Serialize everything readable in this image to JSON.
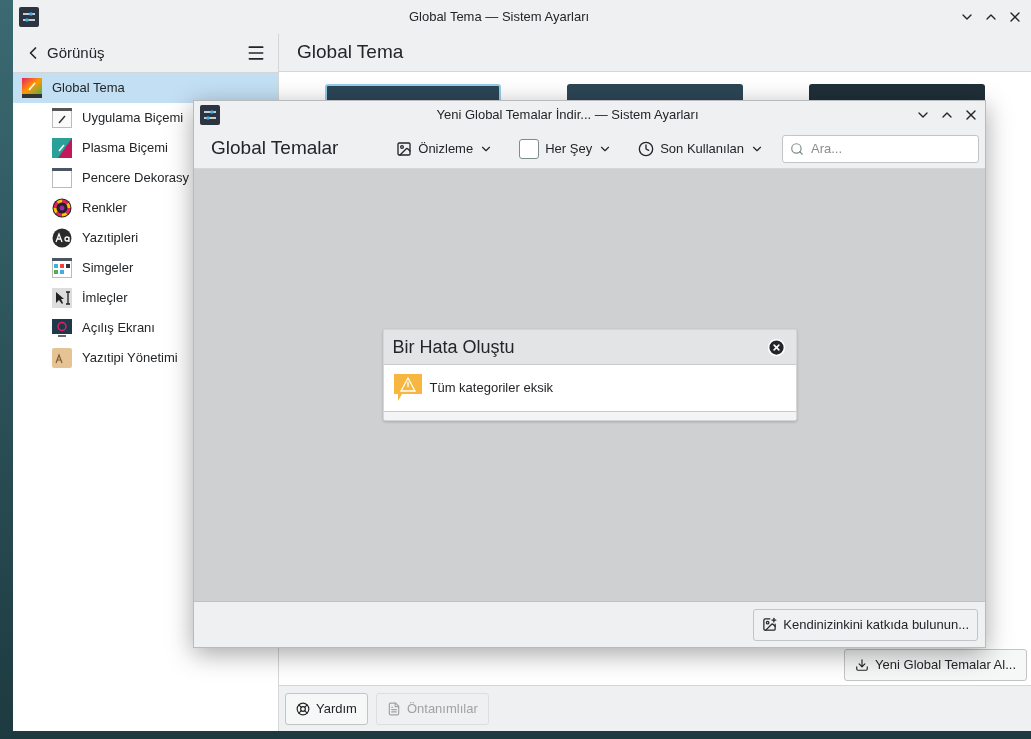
{
  "main_window": {
    "title": "Global Tema — Sistem Ayarları"
  },
  "sidebar": {
    "back_label": "Görünüş",
    "items": [
      {
        "label": "Global Tema",
        "selected": true,
        "children": [
          {
            "label": "Uygulama Biçemi",
            "selected": false
          },
          {
            "label": "Plasma Biçemi",
            "selected": false
          },
          {
            "label": "Pencere Dekorasy",
            "selected": false
          },
          {
            "label": "Renkler",
            "selected": false
          },
          {
            "label": "Yazıtipleri",
            "selected": false
          },
          {
            "label": "Simgeler",
            "selected": false
          },
          {
            "label": "İmleçler",
            "selected": false
          },
          {
            "label": "Açılış Ekranı",
            "selected": false
          },
          {
            "label": "Yazıtipi Yönetimi",
            "selected": false
          }
        ]
      }
    ]
  },
  "page": {
    "title": "Global Tema",
    "get_new_button": "Yeni Global Temalar Al...",
    "help_button": "Yardım",
    "defaults_button": {
      "label": "Öntanımlılar",
      "disabled": true
    }
  },
  "dialog": {
    "title": "Yeni Global Temalar İndir... — Sistem Ayarları",
    "heading": "Global Temalar",
    "view_menu": "Önizleme",
    "filter_menu": "Her Şey",
    "sort_menu": "Son Kullanılan",
    "search": {
      "placeholder": "Ara..."
    },
    "error": {
      "title": "Bir Hata Oluştu",
      "message": "Tüm kategoriler eksik"
    },
    "contribute_button": "Kendinizinkini katkıda bulunun..."
  }
}
